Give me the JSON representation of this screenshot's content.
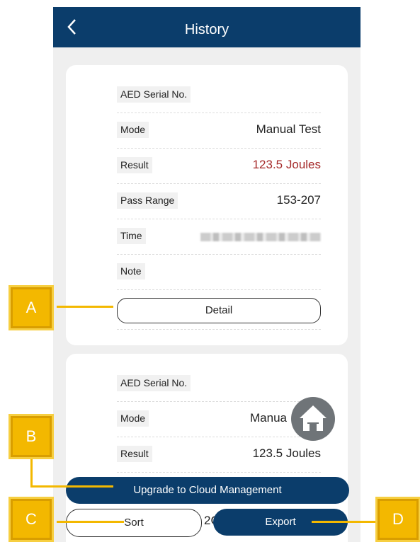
{
  "header": {
    "title": "History",
    "back_icon": "chevron-left-icon"
  },
  "labels": {
    "serial": "AED Serial No.",
    "mode": "Mode",
    "result": "Result",
    "pass_range": "Pass Range",
    "time": "Time",
    "note": "Note"
  },
  "records": [
    {
      "mode": "Manual Test",
      "result": "123.5 Joules",
      "pass_range": "153-207",
      "detail_label": "Detail"
    },
    {
      "mode": "Manua",
      "result": "123.5 Joules"
    }
  ],
  "actions": {
    "upgrade_label": "Upgrade to Cloud Management",
    "sort_label": "Sort",
    "partial_text": "2C",
    "export_label": "Export",
    "home_icon": "home-icon"
  },
  "callouts": [
    "A",
    "B",
    "C",
    "D"
  ],
  "colors": {
    "header_bg": "#0b3d6b",
    "result_red": "#a52a2a",
    "callout_yellow": "#f3b800",
    "home_button": "#6f7478"
  }
}
